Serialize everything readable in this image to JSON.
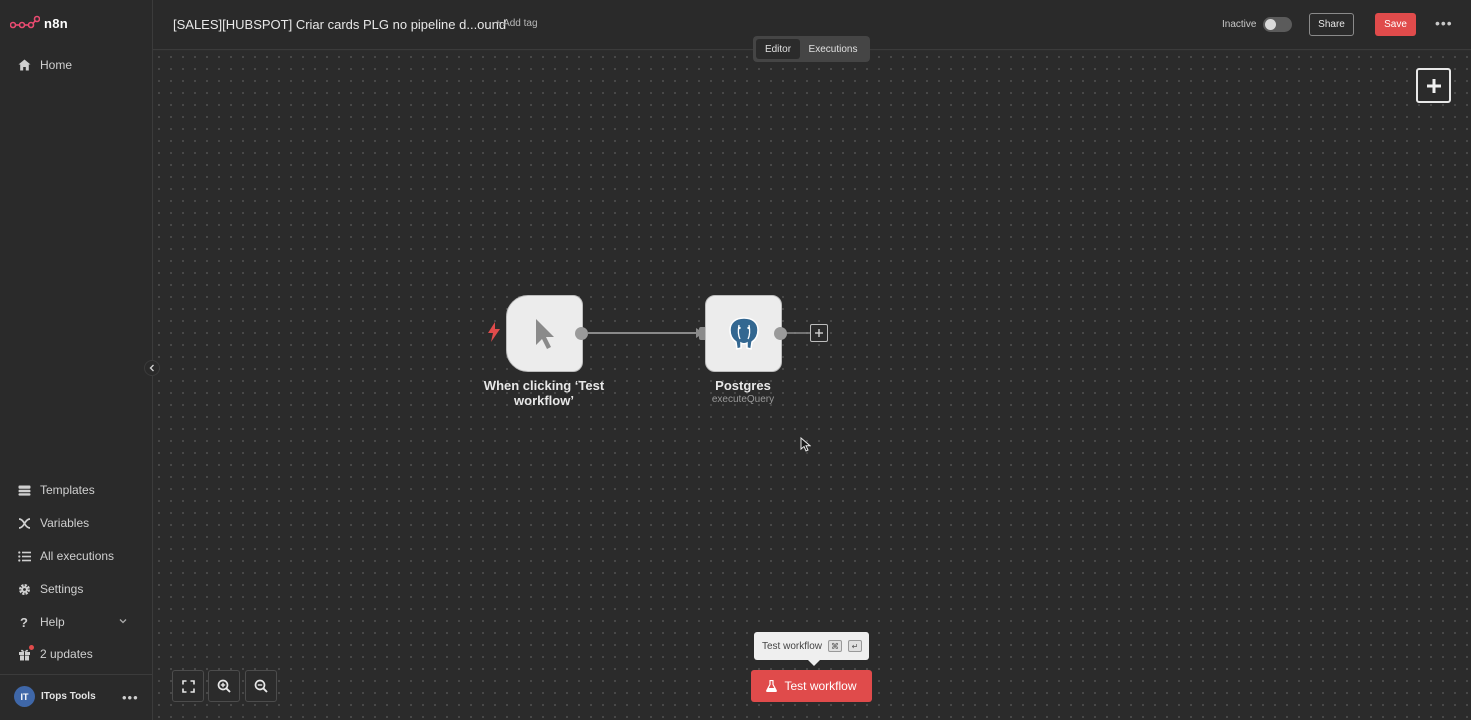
{
  "app": {
    "logo_text": "n8n"
  },
  "header": {
    "workflow_title": "[SALES][HUBSPOT] Criar cards PLG no pipeline d...ound",
    "add_tag_label": "+ Add tag",
    "status_label": "Inactive",
    "share_label": "Share",
    "save_label": "Save"
  },
  "tabs": [
    {
      "label": "Editor",
      "active": true
    },
    {
      "label": "Executions",
      "active": false
    }
  ],
  "sidebar": {
    "top_items": [
      {
        "label": "Home",
        "icon": "home-icon"
      }
    ],
    "bottom_items": [
      {
        "label": "Templates",
        "icon": "templates-icon"
      },
      {
        "label": "Variables",
        "icon": "variables-icon"
      },
      {
        "label": "All executions",
        "icon": "list-icon"
      },
      {
        "label": "Settings",
        "icon": "gear-icon"
      },
      {
        "label": "Help",
        "icon": "question-icon"
      },
      {
        "label": "2 updates",
        "icon": "gift-icon"
      }
    ],
    "user": {
      "initials": "IT",
      "name": "ITops Tools"
    }
  },
  "nodes": [
    {
      "label": "When clicking ‘Test workflow’",
      "subtitle": "",
      "type": "manual-trigger"
    },
    {
      "label": "Postgres",
      "subtitle": "executeQuery",
      "type": "postgres"
    }
  ],
  "footer": {
    "tooltip_label": "Test workflow",
    "tooltip_keys": [
      "⌘",
      "↵"
    ],
    "test_button_label": "Test workflow"
  },
  "colors": {
    "accent": "#e04b4b",
    "canvas": "#2b2b2b",
    "sidebar": "#2a2a2a"
  }
}
